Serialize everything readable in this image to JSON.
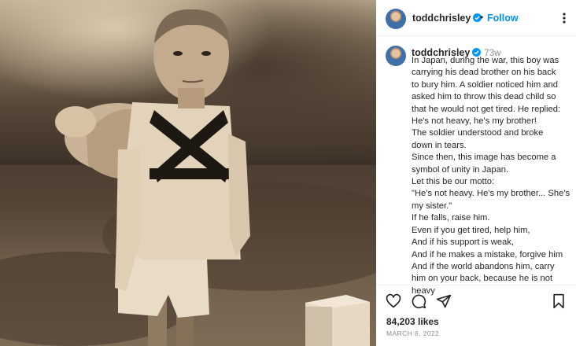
{
  "post": {
    "username": "toddchrisley",
    "follow_label": "Follow",
    "separator": "•",
    "time_ago": "73w",
    "caption_lines": [
      "In Japan, during the war, this boy was",
      "carrying his dead brother on his back",
      "to bury him. A soldier noticed him and",
      "asked him to throw this dead child so",
      "that he would not get tired. He replied:",
      "He's not heavy, he's my brother!",
      "The soldier understood and broke",
      "down in tears.",
      "Since then, this image has become a",
      "symbol of unity in Japan.",
      "Let this be our motto:",
      "\"He's not heavy. He's my brother... She's",
      "my sister.\"",
      "If he falls, raise him.",
      "Even if you get tired, help him,",
      "And if his support is weak,",
      "And if he makes a mistake, forgive him",
      "And if the world abandons him, carry",
      "him on your back, because he is not",
      "heavy"
    ],
    "likes": "84,203 likes",
    "date": "MARCH 8, 2022"
  },
  "icons": {
    "verified": "verified-badge-icon",
    "more": "more-options-icon",
    "like": "heart-icon",
    "comment": "comment-icon",
    "share": "share-icon",
    "save": "bookmark-icon"
  },
  "colors": {
    "accent": "#0095f6",
    "verified": "#0095f6",
    "muted": "#8e8e8e",
    "text": "#262626"
  }
}
